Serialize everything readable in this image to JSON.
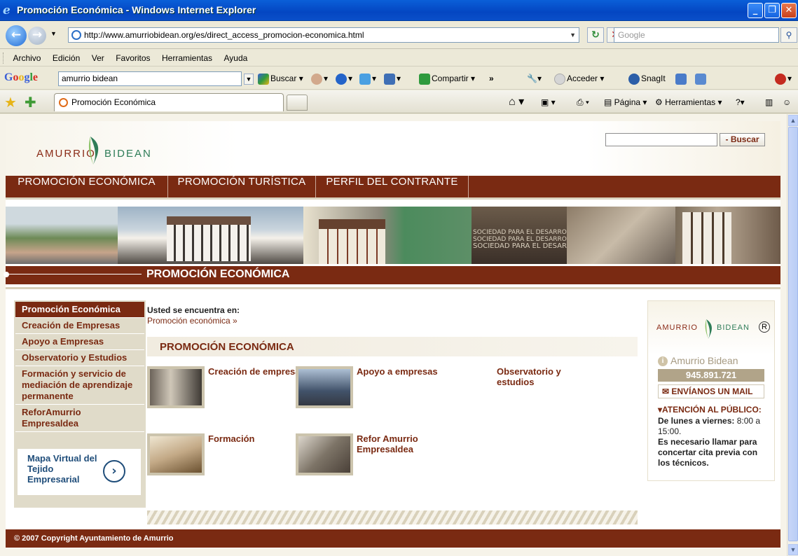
{
  "window": {
    "title": "Promoción Económica - Windows Internet Explorer"
  },
  "browser": {
    "url": "http://www.amurriobidean.org/es/direct_access_promocion-economica.html",
    "search_placeholder": "Google",
    "menu": [
      "Archivo",
      "Edición",
      "Ver",
      "Favoritos",
      "Herramientas",
      "Ayuda"
    ],
    "google_toolbar": {
      "logo": "Google",
      "query": "amurrio bidean",
      "buscar": "Buscar",
      "compartir": "Compartir",
      "acceder": "Acceder",
      "snagit": "SnagIt",
      "more": "»"
    },
    "tab": {
      "label": "Promoción Económica"
    },
    "commands": {
      "pagina": "Página",
      "herramientas": "Herramientas"
    }
  },
  "site": {
    "logo_amurrio": "AMURRIO",
    "logo_bidean": "BIDEAN",
    "search_button": "- Buscar",
    "topnav": [
      "PROMOCIÓN ECONÓMICA",
      "PROMOCIÓN TURÍSTICA",
      "PERFIL DEL CONTRANTE"
    ],
    "banner_text": [
      "SOCIEDAD PARA EL DESARROLLO LOCAL",
      "SOCIEDAD PARA EL DESARROLLO LOCAL",
      "SOCIEDAD PARA EL DESARROLLO LOCAL"
    ],
    "section_title": "PROMOCIÓN ECONÓMICA",
    "left_menu": [
      {
        "label": "Promoción Económica",
        "active": true
      },
      {
        "label": "Creación de Empresas"
      },
      {
        "label": "Apoyo a Empresas"
      },
      {
        "label": "Observatorio y Estudios"
      },
      {
        "label": "Formación y servicio de mediación de aprendizaje permanente"
      },
      {
        "label": "ReforAmurrio Empresaldea"
      }
    ],
    "map_box": {
      "label": "Mapa Virtual del Tejido Empresarial"
    },
    "breadcrumb_label": "Usted se encuentra en:",
    "breadcrumb_link": "Promoción económica »",
    "content_title": "PROMOCIÓN ECONÓMICA",
    "cards": [
      {
        "label": "Creación de empresas"
      },
      {
        "label": "Apoyo a empresas"
      },
      {
        "label": "Observatorio y estudios"
      },
      {
        "label": "Formación"
      },
      {
        "label": "Refor Amurrio Empresaldea"
      }
    ],
    "contact": {
      "logo_a": "AMURRIO",
      "logo_b": "BIDEAN",
      "registered": "R",
      "name": "Amurrio Bidean",
      "phone": "945.891.721",
      "mail": "ENVÍANOS UN MAIL",
      "attention": "ATENCIÓN AL PÚBLICO:",
      "hours_label": "De lunes a viernes:",
      "hours_value": "8:00 a 15:00.",
      "note": "Es necesario llamar para concertar cita previa con los técnicos."
    },
    "footer": "© 2007 Copyright Ayuntamiento de Amurrio"
  },
  "colors": {
    "brand": "#7a2a12",
    "leaf_green": "#2f7d58",
    "xp_blue": "#0446c2"
  }
}
